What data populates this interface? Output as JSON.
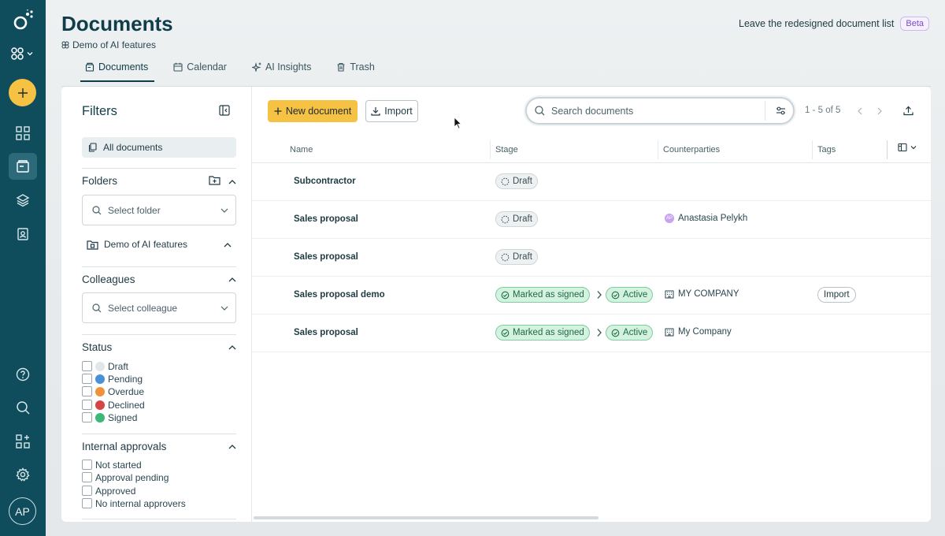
{
  "header": {
    "title": "Documents",
    "subtitle": "Demo of AI features",
    "leave_text": "Leave the redesigned document list",
    "beta_badge": "Beta"
  },
  "tabs": [
    {
      "label": "Documents",
      "icon": "document-icon",
      "active": true
    },
    {
      "label": "Calendar",
      "icon": "calendar-icon",
      "active": false
    },
    {
      "label": "AI Insights",
      "icon": "sparkle-icon",
      "active": false
    },
    {
      "label": "Trash",
      "icon": "trash-icon",
      "active": false
    }
  ],
  "rail": {
    "avatar_initials": "AP",
    "accent": "#f5c243",
    "background": "#0f4c5c"
  },
  "filters": {
    "title": "Filters",
    "all_documents": "All documents",
    "folders": {
      "title": "Folders",
      "placeholder": "Select folder",
      "item": "Demo of AI features"
    },
    "colleagues": {
      "title": "Colleagues",
      "placeholder": "Select colleague"
    },
    "status": {
      "title": "Status",
      "items": [
        {
          "label": "Draft",
          "color": "#e3e6e8"
        },
        {
          "label": "Pending",
          "color": "#4a90d9"
        },
        {
          "label": "Overdue",
          "color": "#f0923a"
        },
        {
          "label": "Declined",
          "color": "#d64545"
        },
        {
          "label": "Signed",
          "color": "#3cb878"
        }
      ]
    },
    "internal_approvals": {
      "title": "Internal approvals",
      "items": [
        "Not started",
        "Approval pending",
        "Approved",
        "No internal approvers"
      ]
    }
  },
  "toolbar": {
    "new_document": "New document",
    "import": "Import",
    "search_placeholder": "Search documents",
    "pagination": "1 - 5 of 5"
  },
  "table": {
    "columns": [
      "Name",
      "Stage",
      "Counterparties",
      "Tags"
    ],
    "rows": [
      {
        "name": "Subcontractor",
        "stage": "Draft",
        "next_stage": "",
        "counterparty": "",
        "counterparty_initials": "",
        "counterparty_type": "",
        "tag": ""
      },
      {
        "name": "Sales proposal",
        "stage": "Draft",
        "next_stage": "",
        "counterparty": "Anastasia Pelykh",
        "counterparty_initials": "AP",
        "counterparty_type": "person",
        "tag": ""
      },
      {
        "name": "Sales proposal",
        "stage": "Draft",
        "next_stage": "",
        "counterparty": "",
        "counterparty_initials": "",
        "counterparty_type": "",
        "tag": ""
      },
      {
        "name": "Sales proposal demo",
        "stage": "Marked as signed",
        "next_stage": "Active",
        "counterparty": "MY COMPANY",
        "counterparty_initials": "",
        "counterparty_type": "company",
        "tag": "Import"
      },
      {
        "name": "Sales proposal",
        "stage": "Marked as signed",
        "next_stage": "Active",
        "counterparty": "My Company",
        "counterparty_initials": "",
        "counterparty_type": "company",
        "tag": ""
      }
    ]
  }
}
